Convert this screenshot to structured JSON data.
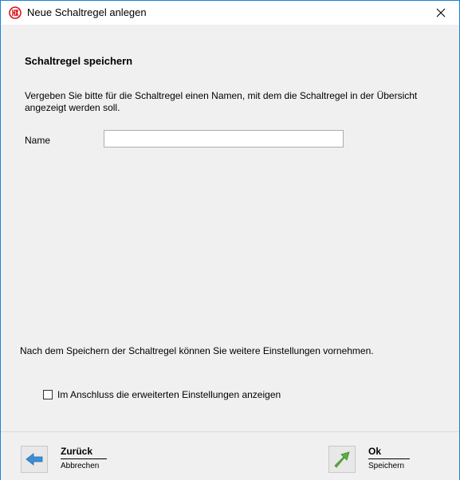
{
  "window": {
    "title": "Neue Schaltregel anlegen",
    "app_icon": "brand-logo-icon",
    "close_icon": "close-icon"
  },
  "content": {
    "heading": "Schaltregel speichern",
    "description": "Vergeben Sie bitte für die Schaltregel einen Namen, mit dem die Schaltregel in der Übersicht angezeigt werden soll.",
    "name_label": "Name",
    "name_value": "",
    "info_text": "Nach dem Speichern der Schaltregel können Sie weitere Einstellungen vornehmen.",
    "checkbox_label": "Im Anschluss die erweiterten Einstellungen anzeigen",
    "checkbox_checked": false
  },
  "footer": {
    "back": {
      "label": "Zurück",
      "sublabel": "Abbrechen",
      "icon": "arrow-left-icon"
    },
    "ok": {
      "label": "Ok",
      "sublabel": "Speichern",
      "icon": "arrow-up-right-icon"
    }
  },
  "colors": {
    "window_border": "#1883d7",
    "brand_red": "#d4121a",
    "back_arrow": "#3b8ed6",
    "ok_arrow": "#5cb040"
  }
}
